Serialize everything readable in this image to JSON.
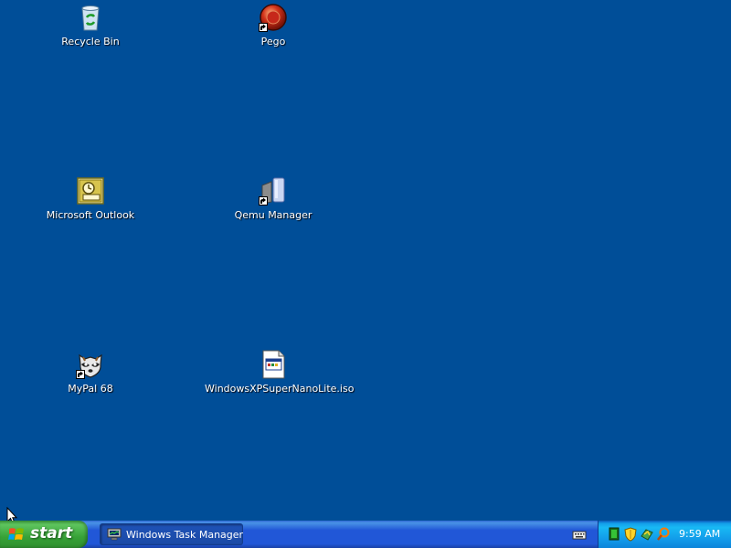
{
  "desktop": {
    "background_color": "#004e98",
    "icons": [
      {
        "label": "Recycle Bin",
        "icon": "recycle-bin-icon",
        "shortcut": false
      },
      {
        "label": "Pego",
        "icon": "pego-icon",
        "shortcut": true
      },
      {
        "label": "Microsoft Outlook",
        "icon": "outlook-icon",
        "shortcut": false
      },
      {
        "label": "Qemu Manager",
        "icon": "qemu-manager-icon",
        "shortcut": true
      },
      {
        "label": "MyPal 68",
        "icon": "mypal-icon",
        "shortcut": true
      },
      {
        "label": "WindowsXPSuperNanoLite.iso",
        "icon": "iso-file-icon",
        "shortcut": false
      }
    ]
  },
  "taskbar": {
    "start_label": "start",
    "start_color": "#37a237",
    "taskbar_color": "#2157d7",
    "tasks": [
      {
        "label": "Windows Task Manager",
        "icon": "task-manager-icon"
      }
    ],
    "language_icon": "keyboard-icon",
    "tray": {
      "icons": [
        "network-icon",
        "security-shield-icon",
        "update-icon",
        "search-icon"
      ],
      "clock": "9:59 AM",
      "color": "#1196e7"
    }
  }
}
